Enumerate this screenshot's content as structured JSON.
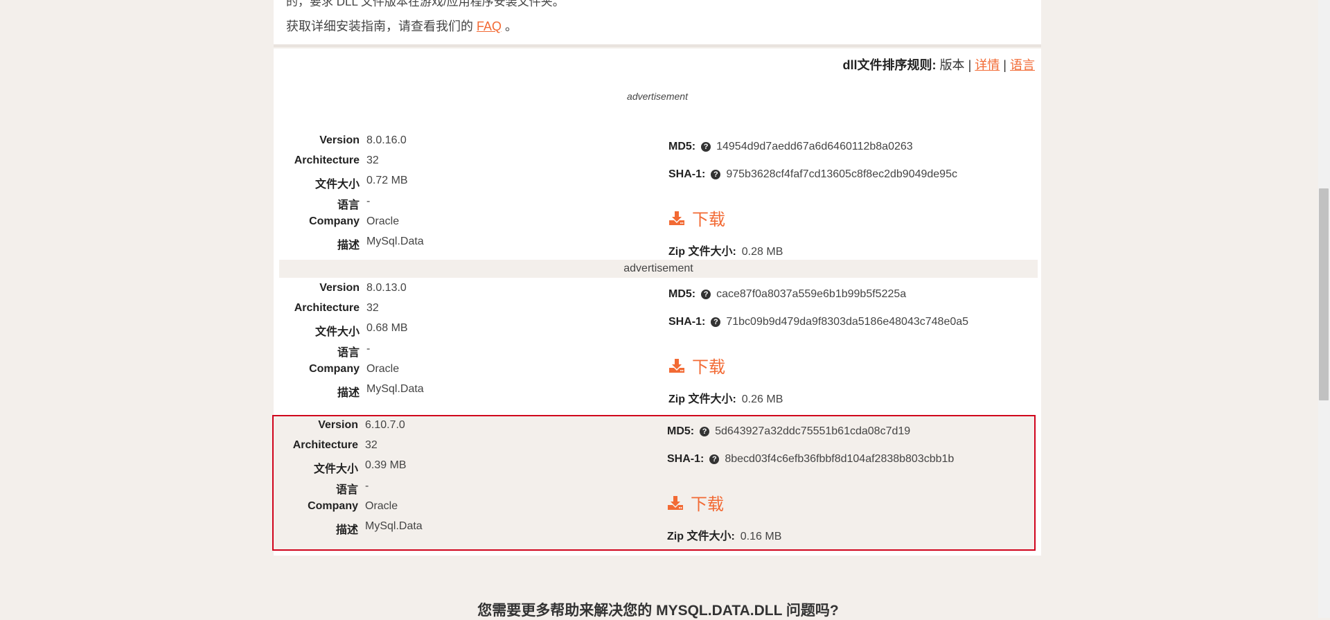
{
  "top_box": {
    "clipped_text": "的，要求 DLL 文件版本在游戏/应用程序安装文件夹。",
    "faq_prefix": "获取详细安装指南，请查看我们的",
    "faq_link": "FAQ",
    "faq_suffix": "。"
  },
  "sort_rule": {
    "label": "dll文件排序规则:",
    "version": "版本",
    "sep1": "|",
    "detail": "详情",
    "sep2": "|",
    "language": "语言"
  },
  "ad_italic": "advertisement",
  "ad_bar": "advertisement",
  "labels": {
    "version": "Version",
    "architecture": "Architecture",
    "size": "文件大小",
    "language": "语言",
    "company": "Company",
    "description": "描述",
    "md5": "MD5:",
    "sha1": "SHA-1:",
    "download": "下载",
    "zip_size": "Zip 文件大小:"
  },
  "entries": [
    {
      "version": "8.0.16.0",
      "architecture": "32",
      "size": "0.72 MB",
      "language": "-",
      "company": "Oracle",
      "description": "MySql.Data",
      "md5": "14954d9d7aedd67a6d6460112b8a0263",
      "sha1": "975b3628cf4faf7cd13605c8f8ec2db9049de95c",
      "zip_size": "0.28 MB"
    },
    {
      "version": "8.0.13.0",
      "architecture": "32",
      "size": "0.68 MB",
      "language": "-",
      "company": "Oracle",
      "description": "MySql.Data",
      "md5": "cace87f0a8037a559e6b1b99b5f5225a",
      "sha1": "71bc09b9d479da9f8303da5186e48043c748e0a5",
      "zip_size": "0.26 MB"
    },
    {
      "version": "6.10.7.0",
      "architecture": "32",
      "size": "0.39 MB",
      "language": "-",
      "company": "Oracle",
      "description": "MySql.Data",
      "md5": "5d643927a32ddc75551b61cda08c7d19",
      "sha1": "8becd03f4c6efb36fbbf8d104af2838b803cbb1b",
      "zip_size": "0.16 MB"
    }
  ],
  "help_title": "您需要更多帮助来解决您的 MYSQL.DATA.DLL 问题吗?",
  "colors": {
    "accent": "#f26a34",
    "highlight_border": "#d0021b",
    "background": "#f3efeb"
  },
  "icons": {
    "question": "question-circle-icon",
    "download": "download-icon"
  }
}
